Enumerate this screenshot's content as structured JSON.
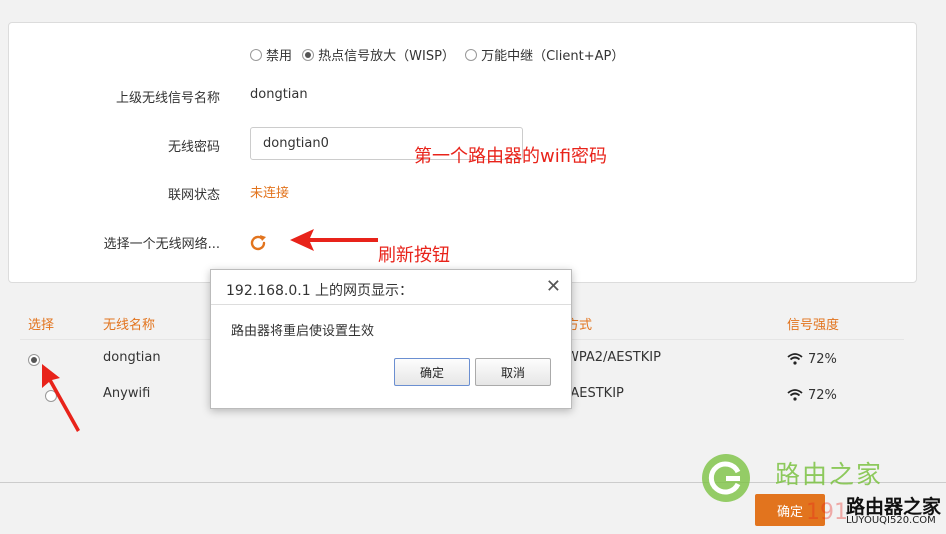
{
  "mode": {
    "options": [
      {
        "label": "禁用",
        "checked": false
      },
      {
        "label": "热点信号放大（WISP）",
        "checked": true
      },
      {
        "label": "万能中继（Client+AP）",
        "checked": false
      }
    ]
  },
  "form": {
    "ssid_label": "上级无线信号名称",
    "ssid_value": "dongtian",
    "password_label": "无线密码",
    "password_value": "dongtian0",
    "status_label": "联网状态",
    "status_value": "未连接",
    "choose_label": "选择一个无线网络...",
    "refresh_icon": "refresh-icon"
  },
  "annotations": {
    "password_note": "第一个路由器的wifi密码",
    "refresh_note": "刷新按钮"
  },
  "table": {
    "headers": {
      "select": "选择",
      "name": "无线名称",
      "security": "方式",
      "signal": "信号强度"
    },
    "rows": [
      {
        "name": "dongtian",
        "security": "WPA2/AESTKIP",
        "signal": "72%",
        "selected": true
      },
      {
        "name": "Anywifi",
        "security": "/AESTKIP",
        "signal": "72%",
        "selected": false
      }
    ]
  },
  "dialog": {
    "title": "192.168.0.1 上的网页显示：",
    "message": "路由器将重启使设置生效",
    "ok_label": "确定",
    "cancel_label": "取消"
  },
  "footer": {
    "ok_label": "确定"
  },
  "watermark": {
    "brand_cn": "路由之家",
    "brand_cn2": "路由器之家",
    "url": "LUYOUQI520.COM",
    "partial": "191"
  },
  "colors": {
    "accent": "#e2741e",
    "annotation": "#e8231a",
    "watermark_green": "#7cc242"
  }
}
